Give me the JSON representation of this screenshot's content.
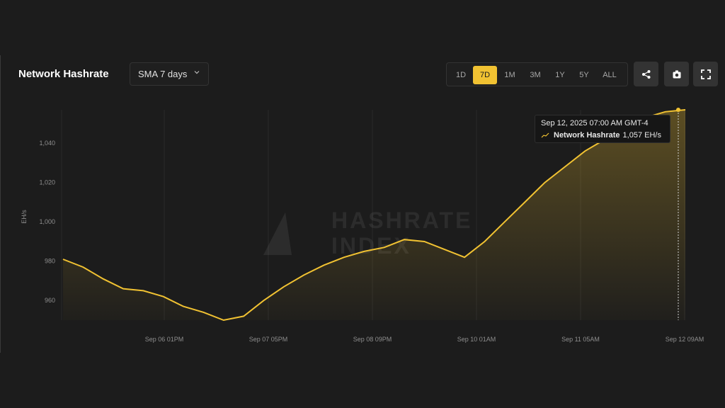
{
  "header": {
    "title": "Network Hashrate",
    "average_select": "SMA 7 days"
  },
  "ranges": [
    {
      "label": "1D",
      "active": false
    },
    {
      "label": "7D",
      "active": true
    },
    {
      "label": "1M",
      "active": false
    },
    {
      "label": "3M",
      "active": false
    },
    {
      "label": "1Y",
      "active": false
    },
    {
      "label": "5Y",
      "active": false
    },
    {
      "label": "ALL",
      "active": false
    }
  ],
  "icons": {
    "share": "share-icon",
    "screenshot": "camera-icon",
    "fullscreen": "fullscreen-icon",
    "select": "chevron-down-icon"
  },
  "colors": {
    "accent": "#f1c232",
    "background": "#1c1c1c"
  },
  "watermark": {
    "line1": "HASHRATE",
    "line2": "INDEX"
  },
  "tooltip": {
    "timestamp": "Sep 12, 2025 07:00 AM GMT-4",
    "series": "Network Hashrate",
    "value": "1,057 EH/s"
  },
  "chart_data": {
    "type": "area",
    "title": "Network Hashrate",
    "ylabel": "EH/s",
    "xlabel": "",
    "ylim": [
      950,
      1057
    ],
    "yticks": [
      960,
      980,
      1000,
      1020,
      1040
    ],
    "ytick_labels": [
      "960",
      "980",
      "1,000",
      "1,020",
      "1,040"
    ],
    "xtick_labels": [
      "Sep 06 01PM",
      "Sep 07 05PM",
      "Sep 08 09PM",
      "Sep 10 01AM",
      "Sep 11 05AM",
      "Sep 12 09AM"
    ],
    "grid": "vertical",
    "series": [
      {
        "name": "Network Hashrate",
        "x": [
          "Sep 05 03AM",
          "Sep 05 09AM",
          "Sep 05 03PM",
          "Sep 05 09PM",
          "Sep 06 03AM",
          "Sep 06 09AM",
          "Sep 06 01PM",
          "Sep 06 07PM",
          "Sep 07 01AM",
          "Sep 07 05AM",
          "Sep 07 11AM",
          "Sep 07 05PM",
          "Sep 07 11PM",
          "Sep 08 05AM",
          "Sep 08 11AM",
          "Sep 08 05PM",
          "Sep 08 09PM",
          "Sep 09 03AM",
          "Sep 09 09AM",
          "Sep 09 03PM",
          "Sep 09 07PM",
          "Sep 10 01AM",
          "Sep 10 07AM",
          "Sep 10 01PM",
          "Sep 10 07PM",
          "Sep 11 01AM",
          "Sep 11 05AM",
          "Sep 11 11AM",
          "Sep 11 05PM",
          "Sep 11 11PM",
          "Sep 12 05AM",
          "Sep 12 07AM"
        ],
        "values": [
          981,
          977,
          971,
          966,
          965,
          962,
          957,
          954,
          950,
          952,
          960,
          967,
          973,
          978,
          982,
          985,
          987,
          991,
          990,
          986,
          982,
          990,
          1000,
          1010,
          1020,
          1028,
          1036,
          1042,
          1049,
          1053,
          1056,
          1057
        ]
      }
    ]
  }
}
